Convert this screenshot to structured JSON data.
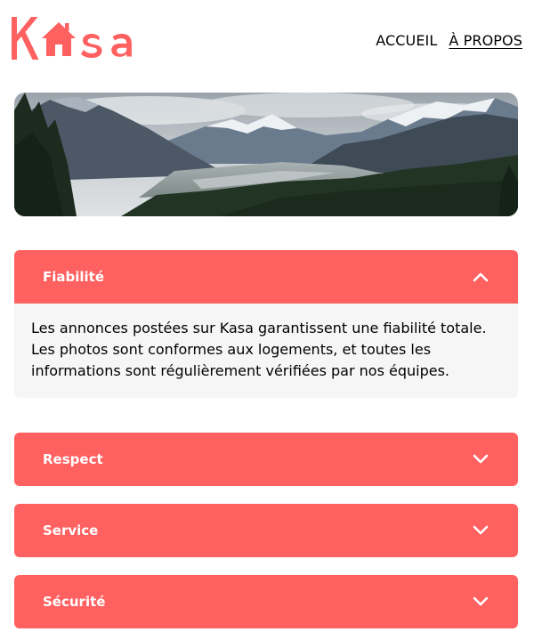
{
  "brand": {
    "name": "Kasa",
    "color": "#FF6060"
  },
  "nav": {
    "items": [
      {
        "label": "ACCUEIL",
        "active": false
      },
      {
        "label": "À PROPOS",
        "active": true
      }
    ]
  },
  "banner": {
    "image": "mountain-landscape"
  },
  "accordion": [
    {
      "title": "Fiabilité",
      "expanded": true,
      "icon": "chevron-up-icon",
      "content": "Les annonces postées sur Kasa garantissent une fiabilité totale. Les photos sont conformes aux logements, et toutes les informations sont régulièrement vérifiées par nos équipes."
    },
    {
      "title": "Respect",
      "expanded": false,
      "icon": "chevron-down-icon"
    },
    {
      "title": "Service",
      "expanded": false,
      "icon": "chevron-down-icon"
    },
    {
      "title": "Sécurité",
      "expanded": false,
      "icon": "chevron-down-icon"
    }
  ],
  "colors": {
    "accent": "#FF6060",
    "panel_background": "#F6F6F6"
  }
}
